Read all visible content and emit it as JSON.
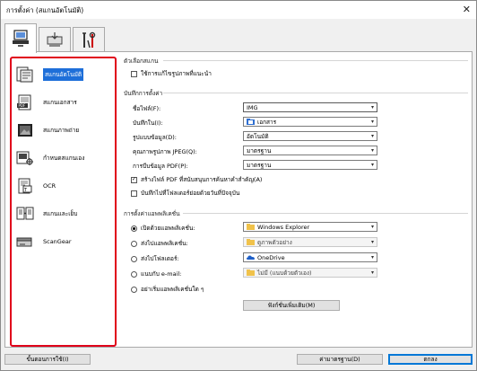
{
  "window": {
    "title": "การตั้งค่า (สแกนอัตโนมัติ)",
    "close_glyph": "✕"
  },
  "tabs": [
    {
      "icon": "computer-scan-icon",
      "active": true
    },
    {
      "icon": "device-scan-icon",
      "active": false
    },
    {
      "icon": "tools-icon",
      "active": false
    }
  ],
  "sidebar": {
    "items": [
      {
        "label": "สแกนอัตโนมัติ",
        "icon": "auto-scan-icon",
        "active": true
      },
      {
        "label": "สแกนเอกสาร",
        "icon": "pdf-document-icon",
        "active": false
      },
      {
        "label": "สแกนภาพถ่าย",
        "icon": "photo-icon",
        "active": false
      },
      {
        "label": "กำหนดสแกนเอง",
        "icon": "custom-scan-icon",
        "active": false
      },
      {
        "label": "OCR",
        "icon": "ocr-icon",
        "active": false
      },
      {
        "label": "สแกนและเย็บ",
        "icon": "stitch-icon",
        "active": false
      },
      {
        "label": "ScanGear",
        "icon": "scangear-icon",
        "active": false
      }
    ]
  },
  "scan_options": {
    "heading": "ตัวเลือกสแกน",
    "recommended_label": "ใช้การแก้ไขรูปภาพที่แนะนำ",
    "recommended_checked": false
  },
  "save_settings": {
    "heading": "บันทึกการตั้งค่า",
    "file_name_label": "ชื่อไฟล์(F):",
    "file_name_value": "IMG",
    "save_in_label": "บันทึกใน(I):",
    "save_in_value": "เอกสาร",
    "data_format_label": "รูปแบบข้อมูล(D):",
    "data_format_value": "อัตโนมัติ",
    "jpeg_quality_label": "คุณภาพรูปภาพ JPEG(Q):",
    "jpeg_quality_value": "มาตรฐาน",
    "pdf_compression_label": "การบีบข้อมูล PDF(P):",
    "pdf_compression_value": "มาตรฐาน",
    "searchable_pdf_label": "สร้างไฟล์ PDF ที่สนับสนุนการค้นหาคำสำคัญ(A)",
    "searchable_pdf_checked": true,
    "subfolder_label": "บันทึกไปที่โฟลเดอร์ย่อยด้วยวันที่ปัจจุบัน",
    "subfolder_checked": false
  },
  "app_settings": {
    "heading": "การตั้งค่าแอพพลิเคชั่น",
    "options": [
      {
        "label": "เปิดด้วยแอพพลิเคชั่น:",
        "value": "Windows Explorer",
        "selected": true,
        "enabled": true,
        "icon": "folder-icon"
      },
      {
        "label": "ส่งไปแอพพลิเคชั่น:",
        "value": "ดูภาพตัวอย่าง",
        "selected": false,
        "enabled": false,
        "icon": "folder-icon"
      },
      {
        "label": "ส่งไปโฟลเดอร์:",
        "value": "OneDrive",
        "selected": false,
        "enabled": true,
        "icon": "onedrive-icon"
      },
      {
        "label": "แนบกับ e-mail:",
        "value": "ไม่มี (แนบด้วยตัวเอง)",
        "selected": false,
        "enabled": false,
        "icon": "folder-icon"
      },
      {
        "label": "อย่าเริ่มแอพพลิเคชั่นใด ๆ",
        "value": "",
        "selected": false,
        "enabled": true,
        "icon": ""
      }
    ],
    "more_functions_label": "ฟังก์ชั่นเพิ่มเติม(M)"
  },
  "footer": {
    "instructions_label": "ขั้นตอนการใช้(I)",
    "defaults_label": "ค่ามาตรฐาน(D)",
    "ok_label": "ตกลง"
  },
  "colors": {
    "accent": "#1e6fd9",
    "highlight_border": "#e0001a",
    "folder": "#f0c24b"
  }
}
